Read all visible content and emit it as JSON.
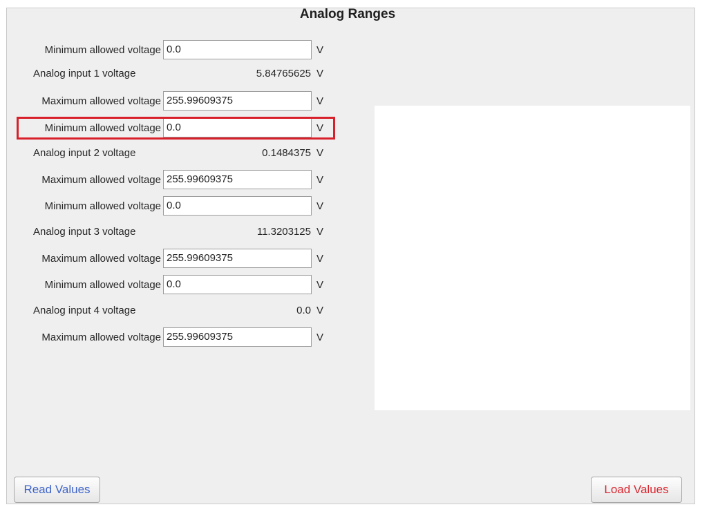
{
  "panel": {
    "title": "Analog Ranges"
  },
  "inputs": [
    {
      "id": 1,
      "min_label": "Minimum allowed voltage",
      "min_value": "0.0",
      "reading_label": "Analog input 1 voltage",
      "reading_value": "5.84765625",
      "max_label": "Maximum allowed voltage",
      "max_value": "255.99609375",
      "unit": "V"
    },
    {
      "id": 2,
      "min_label": "Minimum allowed voltage",
      "min_value": "0.0",
      "reading_label": "Analog input 2 voltage",
      "reading_value": "0.1484375",
      "max_label": "Maximum allowed voltage",
      "max_value": "255.99609375",
      "unit": "V"
    },
    {
      "id": 3,
      "min_label": "Minimum allowed voltage",
      "min_value": "0.0",
      "reading_label": "Analog input 3 voltage",
      "reading_value": "11.3203125",
      "max_label": "Maximum allowed voltage",
      "max_value": "255.99609375",
      "unit": "V"
    },
    {
      "id": 4,
      "min_label": "Minimum allowed voltage",
      "min_value": "0.0",
      "reading_label": "Analog input 4 voltage",
      "reading_value": "0.0",
      "max_label": "Maximum allowed voltage",
      "max_value": "255.99609375",
      "unit": "V"
    }
  ],
  "buttons": {
    "read_label": "Read Values",
    "load_label": "Load Values"
  },
  "colors": {
    "highlight": "#d8202a",
    "read_text": "#3d63c9",
    "load_text": "#d9252f"
  }
}
